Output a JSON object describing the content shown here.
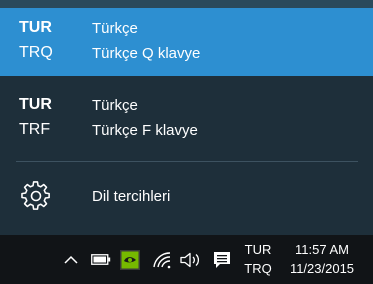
{
  "flyout": {
    "languages": [
      {
        "code": "TUR",
        "layout_code": "TRQ",
        "name": "Türkçe",
        "layout": "Türkçe Q klavye",
        "selected": true
      },
      {
        "code": "TUR",
        "layout_code": "TRF",
        "name": "Türkçe",
        "layout": "Türkçe F klavye",
        "selected": false
      }
    ],
    "preferences_label": "Dil tercihleri",
    "preferences_icon": "gear-icon"
  },
  "taskbar": {
    "icons": [
      "chevron-up-icon",
      "battery-icon",
      "nvidia-icon",
      "wifi-icon",
      "volume-icon",
      "action-center-icon"
    ],
    "lang_top": "TUR",
    "lang_bottom": "TRQ",
    "time": "11:57 AM",
    "date": "11/23/2015"
  },
  "colors": {
    "selected": "#2d8fd1",
    "flyout_bg": "#1e2f3a",
    "taskbar_bg": "#111417",
    "nvidia_green": "#76b900"
  }
}
